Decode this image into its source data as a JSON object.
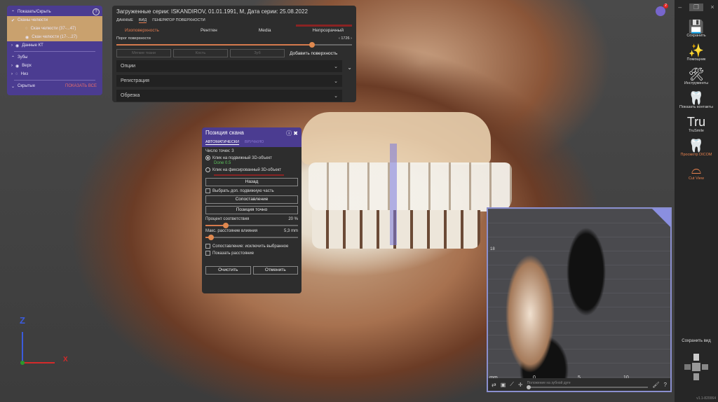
{
  "left_panel": {
    "title": "Показать/Скрыть",
    "help": "?",
    "items": [
      {
        "label": "Сканы челюсти",
        "level": 0
      },
      {
        "label": "Скан челюсти (37-...47)",
        "level": 1
      },
      {
        "label": "Скан челюсти (17-...27)",
        "level": 1
      },
      {
        "label": "Данные КТ",
        "level": 0
      },
      {
        "label": "Зубы",
        "level": 0
      },
      {
        "label": "Верх",
        "level": 1
      },
      {
        "label": "Низ",
        "level": 1
      }
    ],
    "hidden": "Скрытые",
    "show_all": "ПОКАЗАТЬ ВСЕ"
  },
  "top_panel": {
    "title": "Загруженные серии: ISKANDIROV, 01.01.1991, M, Дата серии: 25.08.2022",
    "tabs": [
      "ДАННЫЕ",
      "ВИД",
      "ГЕНЕРАТОР ПОВЕРХНОСТИ"
    ],
    "modes": [
      "Изоповерхность",
      "Рентген",
      "Media",
      "Непрозрачный"
    ],
    "threshold_label": "Порог поверхности",
    "threshold_value": "1726",
    "threshold_fraction": 0.83,
    "buttons": [
      "Мягкие ткани",
      "Кость",
      "Зуб"
    ],
    "add_surface": "Добавить поверхность",
    "sections": [
      "Опции",
      "Регистрация",
      "Обрезка"
    ]
  },
  "scan_dialog": {
    "title": "Позиция скана",
    "tabs": [
      "АВТОМАТИЧЕСКИ",
      "ВРУЧНУЮ"
    ],
    "points": "Число точек: 3",
    "radio1": "Клик на подвижный 3D-объект",
    "radio1_note": "Done 0.5",
    "radio2": "Клик на фиксированный 3D-объект",
    "back": "Назад",
    "extra_part": "Выбрать доп. подвижную часть",
    "match": "Сопоставление",
    "precise": "Позиция точно",
    "percent_label": "Процент соответствия",
    "percent_value": "20 %",
    "percent_fraction": 0.22,
    "dist_label": "Макс. расстояние влияния",
    "dist_value": "5,3 mm",
    "dist_fraction": 0.06,
    "exclude": "Сопоставление: исключить выбранное",
    "show_dist": "Показать расстояние",
    "clear": "Очистить",
    "cancel": "Отменить"
  },
  "sidebar": {
    "items": [
      {
        "label": "Сохранить",
        "icon": "save-icon",
        "glyph": "💾"
      },
      {
        "label": "Помощник",
        "icon": "magic-wand-icon",
        "glyph": "✨"
      },
      {
        "label": "Инструменты",
        "icon": "tools-icon",
        "glyph": "🛠"
      },
      {
        "label": "Показать контакты",
        "icon": "contacts-icon",
        "glyph": "🦷"
      },
      {
        "label": "TruSmile",
        "icon": "trusmile-icon",
        "glyph": "Tru"
      },
      {
        "label": "Просмотр DICOM",
        "icon": "dicom-icon",
        "glyph": "🦷"
      },
      {
        "label": "Cut View",
        "icon": "cut-view-icon",
        "glyph": "⌓"
      }
    ],
    "save_view": "Сохранить вид",
    "version": "v1.1-820064"
  },
  "inset": {
    "unit": "mm",
    "ticks": [
      "0",
      "5",
      "10"
    ],
    "side_label": "18",
    "slider_label": "Положение на зубной дуге",
    "slider_fraction": 0.0
  },
  "axes": {
    "z": "Z",
    "x": "X"
  },
  "notifications": {
    "count": "2"
  },
  "colors": {
    "accent": "#e27a4e",
    "purple": "#4b3c91"
  }
}
